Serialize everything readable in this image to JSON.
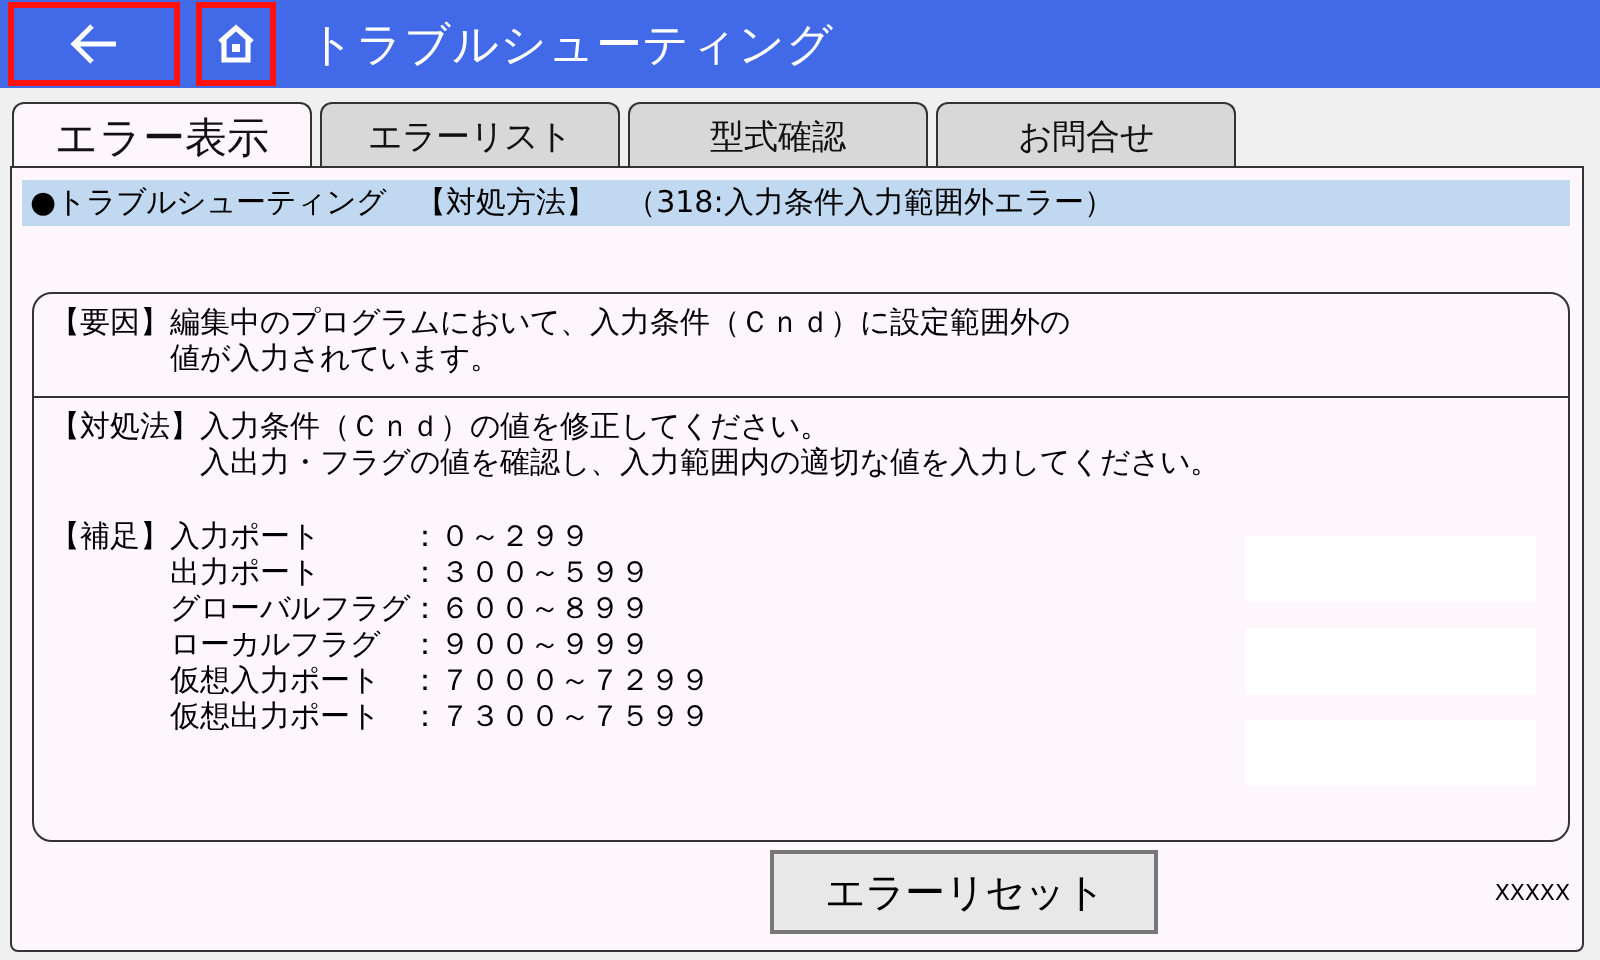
{
  "header": {
    "title": "トラブルシューティング",
    "buttons": [
      {
        "kind": "back",
        "highlighted": true
      },
      {
        "kind": "home",
        "highlighted": true
      }
    ]
  },
  "tabs": [
    {
      "label": "エラー表示",
      "selected": true
    },
    {
      "label": "エラーリスト",
      "selected": false
    },
    {
      "label": "型式確認",
      "selected": false
    },
    {
      "label": "お問合せ",
      "selected": false
    }
  ],
  "heading": "●トラブルシューティング　【対処方法】　（318:入力条件入力範囲外エラー）",
  "cause": {
    "label": "【要因】",
    "lines": [
      "編集中のプログラムにおいて、入力条件（Ｃｎｄ）に設定範囲外の",
      "値が入力されています。"
    ]
  },
  "remedy": {
    "label": "【対処法】",
    "lines": [
      "入力条件（Ｃｎｄ）の値を修正してください。",
      "入出力・フラグの値を確認し、入力範囲内の適切な値を入力してください。"
    ]
  },
  "supplement": {
    "label": "【補足】",
    "rows": [
      {
        "name": "入力ポート",
        "range": "：０～２９９"
      },
      {
        "name": "出力ポート",
        "range": "：３００～５９９"
      },
      {
        "name": "グローバルフラグ",
        "range": "：６００～８９９"
      },
      {
        "name": "ローカルフラグ",
        "range": "：９００～９９９"
      },
      {
        "name": "仮想入力ポート",
        "range": "：７０００～７２９９"
      },
      {
        "name": "仮想出力ポート",
        "range": "：７３００～７５９９"
      }
    ]
  },
  "reset_button": "エラーリセット",
  "code": "XXXXX"
}
